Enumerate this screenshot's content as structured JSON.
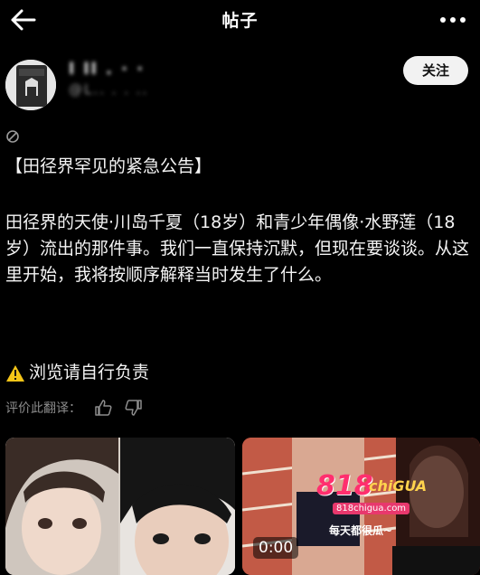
{
  "header": {
    "title": "帖子"
  },
  "author": {
    "name": "l ll . ·  ·",
    "handle": "@L..  . . .."
  },
  "actions": {
    "follow_label": "关注"
  },
  "post": {
    "headline": "【田径界罕见的紧急公告】",
    "body": "田径界的天使·川岛千夏（18岁）和青少年偶像·水野莲（18岁）流出的那件事。我们一直保持沉默，但现在要谈谈。从这里开始，我将按顺序解释当时发生了什么。",
    "warning": "浏览请自行负责",
    "translate_label": "评价此翻译："
  },
  "media": {
    "video_duration": "0:00",
    "ad_text_main": "818",
    "ad_text_chi": "chiGUA",
    "ad_url": "818chigua.com",
    "ad_slogan": "每天都很瓜~"
  },
  "colors": {
    "background": "#000000",
    "text": "#ffffff",
    "muted": "#8c8c8c",
    "button_bg": "#f2f2f2"
  }
}
